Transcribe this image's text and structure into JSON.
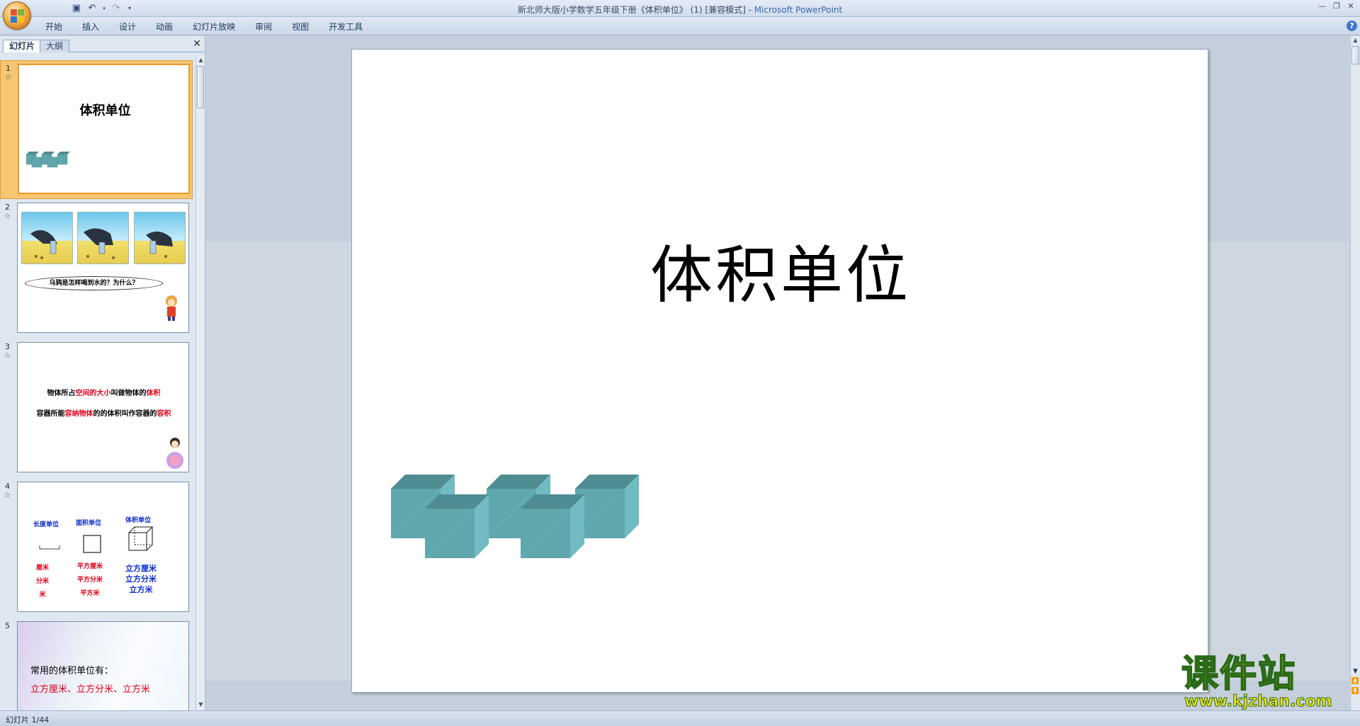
{
  "window": {
    "title": "新北师大版小学数学五年级下册《体积单位》 (1) [兼容模式] - ",
    "app_name": "Microsoft PowerPoint"
  },
  "ribbon": {
    "tabs": [
      "开始",
      "插入",
      "设计",
      "动画",
      "幻灯片放映",
      "审阅",
      "视图",
      "开发工具"
    ]
  },
  "left_panel": {
    "tab_slides": "幻灯片",
    "tab_outline": "大纲",
    "close_glyph": "✕"
  },
  "thumbnails": [
    {
      "number": "1",
      "title": "体积单位"
    },
    {
      "number": "2",
      "bubble": "乌鸦是怎样喝到水的？为什么？"
    },
    {
      "number": "3",
      "line1": [
        "物体所占",
        "空间的大小",
        "叫做物体的",
        "体积"
      ],
      "line2": [
        "容器所能",
        "容纳物体",
        "的的体积叫作容器的",
        "容积"
      ]
    },
    {
      "number": "4",
      "headers": [
        "长度单位",
        "面积单位",
        "体积单位"
      ],
      "length_units": [
        "厘米",
        "分米",
        "米"
      ],
      "area_units": [
        "平方厘米",
        "平方分米",
        "平方米"
      ],
      "volume_units": [
        "立方厘米",
        "立方分米",
        "立方米"
      ]
    },
    {
      "number": "5",
      "line1": "常用的体积单位有：",
      "line2": "立方厘米、立方分米、立方米"
    }
  ],
  "slide": {
    "title": "体积单位"
  },
  "status": {
    "slide_indicator": "幻灯片 1/44"
  },
  "watermark": {
    "title": "课件站",
    "url": "www.kjzhan.com"
  },
  "colors": {
    "cube_front": "#5fa7ad",
    "cube_top": "#4e8c92",
    "cube_side": "#6fbcc2",
    "selected_thumb": "#f7c673",
    "text_red": "#e0001a",
    "text_blue": "#0a2cd0"
  }
}
